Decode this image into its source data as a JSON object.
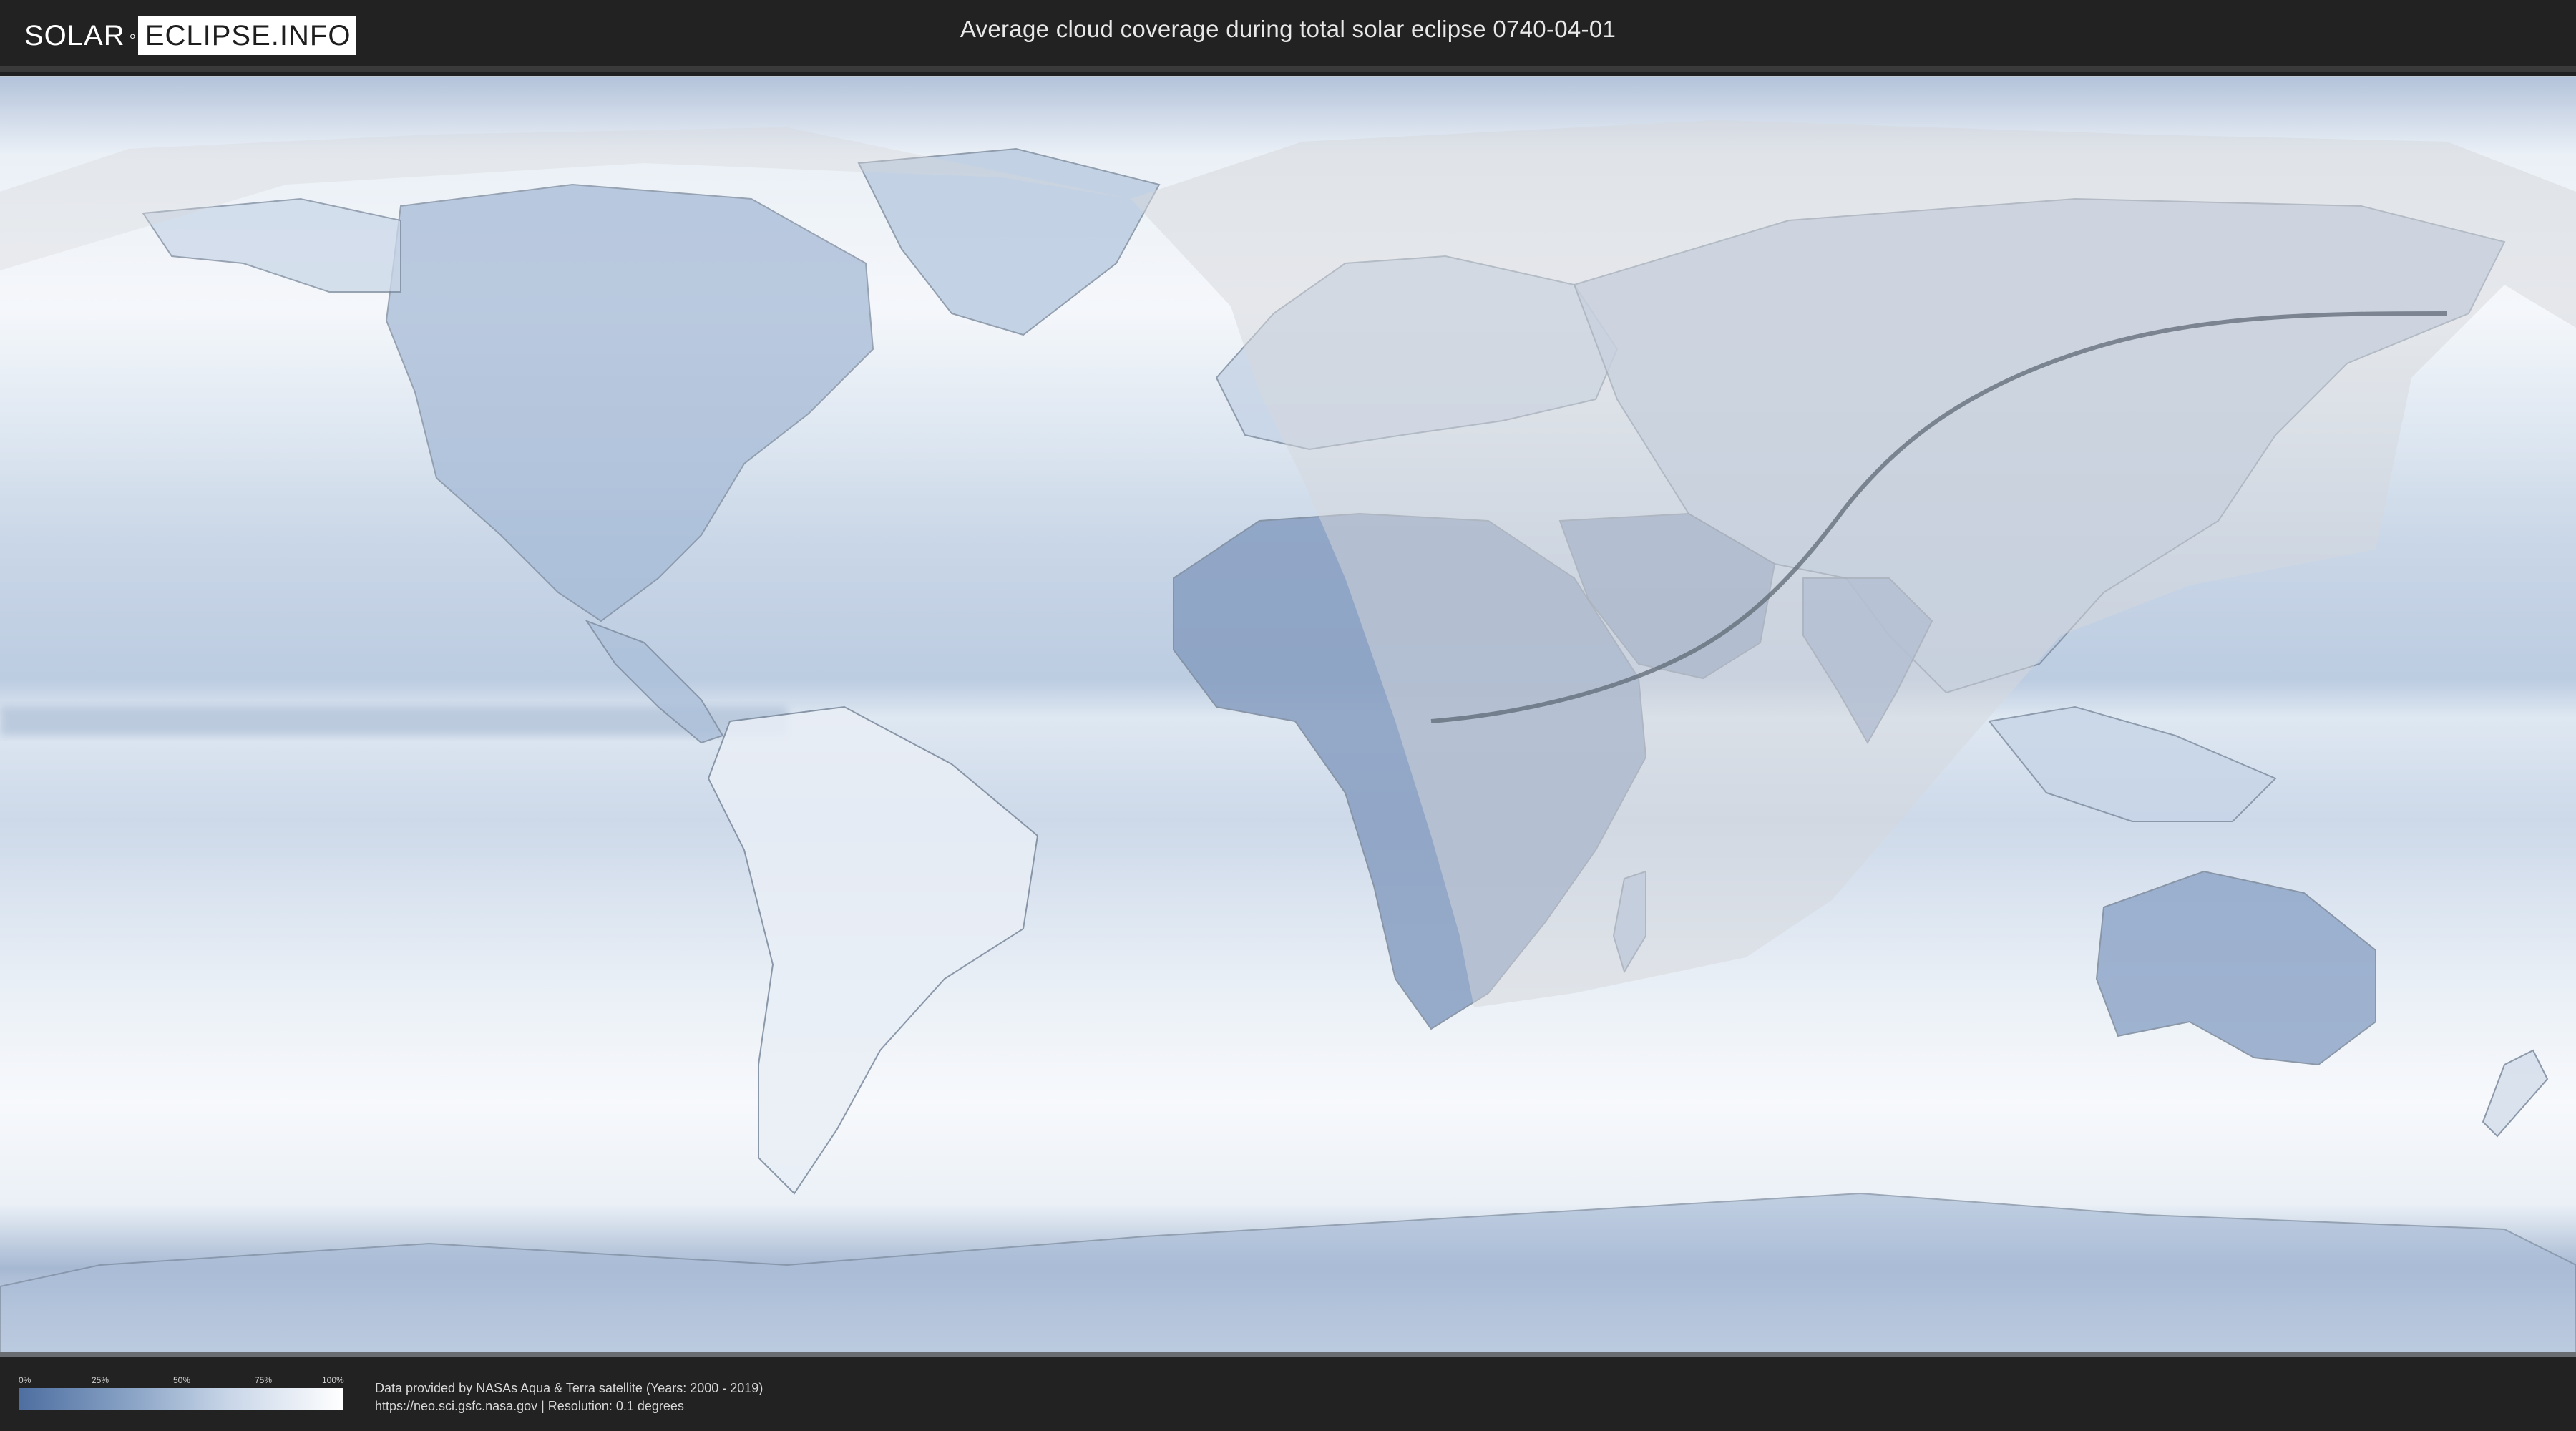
{
  "header": {
    "logo_solar": "SOLAR",
    "logo_eclipse": "ECLIPSE.INFO",
    "title": "Average cloud coverage during total solar eclipse 0740-04-01"
  },
  "legend": {
    "ticks": [
      "0%",
      "25%",
      "50%",
      "75%",
      "100%"
    ],
    "colors": {
      "low": "#4d6ea0",
      "high": "#ffffff"
    }
  },
  "footer": {
    "source_line": "Data provided by NASAs Aqua & Terra satellite (Years: 2000 - 2019)",
    "info_line": "https://neo.sci.gsfc.nasa.gov | Resolution: 0.1 degrees"
  },
  "map": {
    "projection": "equirectangular",
    "layer": "cloud coverage",
    "eclipse_path_color": "#5f6a76",
    "visibility_zone": "shaded"
  }
}
